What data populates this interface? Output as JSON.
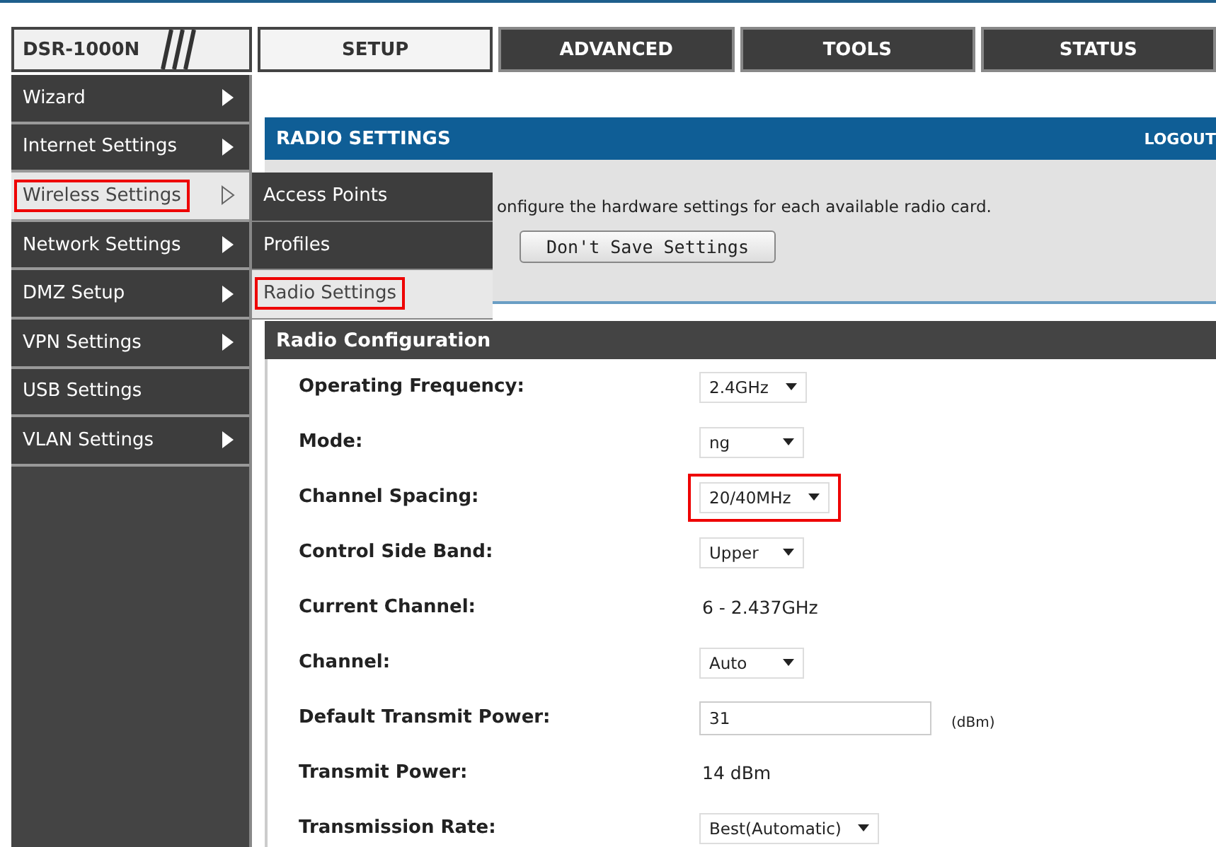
{
  "header": {
    "logo": "DSR-1000N"
  },
  "tabs": [
    {
      "label": "SETUP",
      "selected": true
    },
    {
      "label": "ADVANCED",
      "selected": false
    },
    {
      "label": "TOOLS",
      "selected": false
    },
    {
      "label": "STATUS",
      "selected": false
    }
  ],
  "sidebar": {
    "items": [
      {
        "label": "Wizard",
        "selected": false,
        "highlighted": false,
        "has_submenu": true
      },
      {
        "label": "Internet Settings",
        "selected": false,
        "highlighted": false,
        "has_submenu": true
      },
      {
        "label": "Wireless Settings",
        "selected": true,
        "highlighted": true,
        "has_submenu": true
      },
      {
        "label": "Network Settings",
        "selected": false,
        "highlighted": false,
        "has_submenu": true
      },
      {
        "label": "DMZ Setup",
        "selected": false,
        "highlighted": false,
        "has_submenu": true
      },
      {
        "label": "VPN Settings",
        "selected": false,
        "highlighted": false,
        "has_submenu": true
      },
      {
        "label": "USB Settings",
        "selected": false,
        "highlighted": false,
        "has_submenu": false
      },
      {
        "label": "VLAN Settings",
        "selected": false,
        "highlighted": false,
        "has_submenu": true
      }
    ]
  },
  "submenu": {
    "items": [
      {
        "label": "Access Points",
        "selected": false,
        "highlighted": false
      },
      {
        "label": "Profiles",
        "selected": false,
        "highlighted": false
      },
      {
        "label": "Radio Settings",
        "selected": true,
        "highlighted": true
      }
    ]
  },
  "page": {
    "title": "RADIO SETTINGS",
    "logout": "LOGOUT",
    "description": "onfigure the hardware settings for each available radio card.",
    "buttons": [
      "Don't Save Settings"
    ]
  },
  "section": {
    "title": "Radio Configuration",
    "rows": [
      {
        "label": "Operating Frequency:",
        "kind": "select",
        "value": "2.4GHz",
        "highlighted": false
      },
      {
        "label": "Mode:",
        "kind": "select",
        "value": "ng",
        "highlighted": false
      },
      {
        "label": "Channel Spacing:",
        "kind": "select",
        "value": "20/40MHz",
        "highlighted": true
      },
      {
        "label": "Control Side Band:",
        "kind": "select",
        "value": "Upper",
        "highlighted": false
      },
      {
        "label": "Current Channel:",
        "kind": "text",
        "value": "6 - 2.437GHz",
        "highlighted": false
      },
      {
        "label": "Channel:",
        "kind": "select",
        "value": "Auto",
        "highlighted": false
      },
      {
        "label": "Default Transmit Power:",
        "kind": "input",
        "value": "31",
        "unit": "(dBm)",
        "highlighted": false
      },
      {
        "label": "Transmit Power:",
        "kind": "text",
        "value": "14 dBm",
        "highlighted": false
      },
      {
        "label": "Transmission Rate:",
        "kind": "select",
        "value": "Best(Automatic)",
        "highlighted": false
      }
    ]
  }
}
